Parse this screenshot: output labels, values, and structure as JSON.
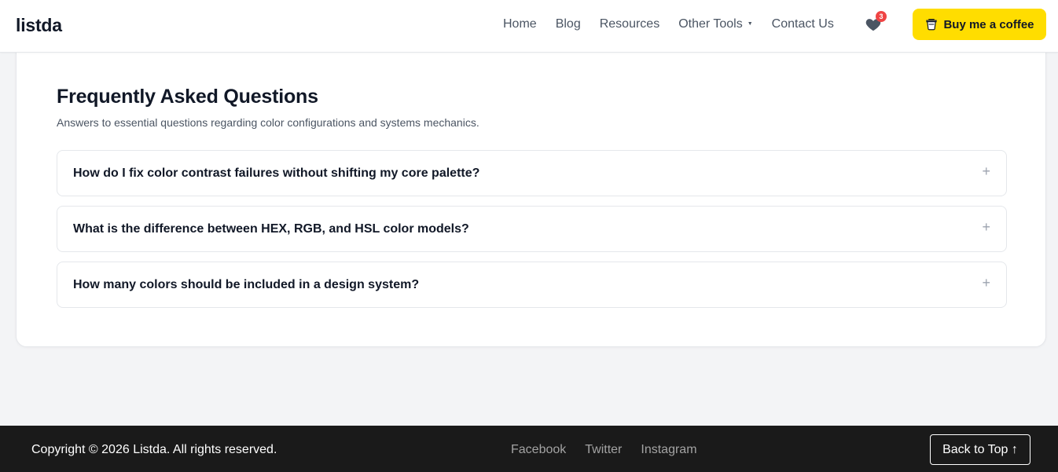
{
  "header": {
    "logo": "listda",
    "nav": [
      {
        "label": "Home"
      },
      {
        "label": "Blog"
      },
      {
        "label": "Resources"
      },
      {
        "label": "Other Tools"
      },
      {
        "label": "Contact Us"
      }
    ],
    "favorites_count": "3",
    "coffee_label": "Buy me a coffee"
  },
  "faq": {
    "title": "Frequently Asked Questions",
    "subtitle": "Answers to essential questions regarding color configurations and systems mechanics.",
    "items": [
      {
        "question": "How do I fix color contrast failures without shifting my core palette?",
        "expand_symbol": "+"
      },
      {
        "question": "What is the difference between HEX, RGB, and HSL color models?",
        "expand_symbol": "+"
      },
      {
        "question": "How many colors should be included in a design system?",
        "expand_symbol": "+"
      }
    ]
  },
  "footer": {
    "copyright": "Copyright © 2026 Listda. All rights reserved.",
    "social": [
      {
        "label": "Facebook"
      },
      {
        "label": "Twitter"
      },
      {
        "label": "Instagram"
      }
    ],
    "back_to_top": "Back to Top ↑"
  },
  "colors": {
    "accent_yellow": "#ffdd00",
    "badge_red": "#ef4444",
    "footer_bg": "#1a1a1a",
    "page_bg": "#f3f4f6"
  }
}
